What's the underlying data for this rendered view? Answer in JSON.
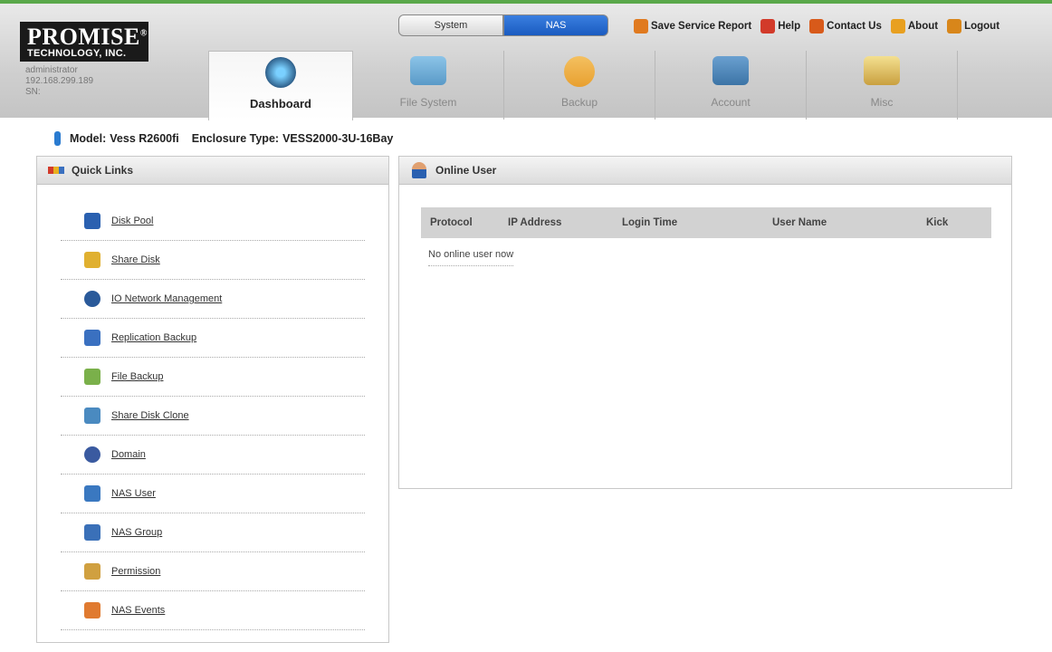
{
  "brand": {
    "name": "PROMISE",
    "registered": "®",
    "subline": "TECHNOLOGY, INC."
  },
  "user": {
    "name": "administrator",
    "ip": "192.168.299.189",
    "sn": "SN:"
  },
  "mode_tabs": [
    {
      "label": "System"
    },
    {
      "label": "NAS"
    }
  ],
  "top_links": [
    {
      "label": "Save Service Report",
      "icon": "report-icon",
      "color": "#e07a1f"
    },
    {
      "label": "Help",
      "icon": "help-icon",
      "color": "#d23a2a"
    },
    {
      "label": "Contact Us",
      "icon": "contact-icon",
      "color": "#d85a1a"
    },
    {
      "label": "About",
      "icon": "about-icon",
      "color": "#e8a020"
    },
    {
      "label": "Logout",
      "icon": "logout-icon",
      "color": "#d8861a"
    }
  ],
  "nav_tabs": [
    {
      "label": "Dashboard",
      "icon": "gauge-icon",
      "color": "#2e5f8a"
    },
    {
      "label": "File System",
      "icon": "folder-gear-icon",
      "color": "#5a9ac8"
    },
    {
      "label": "Backup",
      "icon": "backup-icon",
      "color": "#e8a030"
    },
    {
      "label": "Account",
      "icon": "account-icon",
      "color": "#3c74a6"
    },
    {
      "label": "Misc",
      "icon": "notepad-icon",
      "color": "#c9a040"
    }
  ],
  "model": {
    "model_label": "Model:",
    "model_value": "Vess R2600fi",
    "enclosure_label": "Enclosure Type:",
    "enclosure_value": "VESS2000-3U-16Bay"
  },
  "quick_links": {
    "title": "Quick Links",
    "items": [
      {
        "label": "Disk Pool",
        "icon": "disk-pool-icon",
        "color": "#2a60b0"
      },
      {
        "label": "Share Disk",
        "icon": "share-disk-icon",
        "color": "#e0b030"
      },
      {
        "label": "IO Network Management",
        "icon": "network-icon",
        "color": "#2a5a9a"
      },
      {
        "label": "Replication Backup",
        "icon": "replication-icon",
        "color": "#3a70c0"
      },
      {
        "label": "File Backup",
        "icon": "file-backup-icon",
        "color": "#7ab04a"
      },
      {
        "label": "Share Disk Clone",
        "icon": "clone-icon",
        "color": "#4a8ac0"
      },
      {
        "label": "Domain",
        "icon": "domain-icon",
        "color": "#3a5aa0"
      },
      {
        "label": "NAS User",
        "icon": "nas-user-icon",
        "color": "#3a78c0"
      },
      {
        "label": "NAS Group",
        "icon": "nas-group-icon",
        "color": "#3a70b8"
      },
      {
        "label": "Permission",
        "icon": "permission-icon",
        "color": "#d0a040"
      },
      {
        "label": "NAS Events",
        "icon": "nas-events-icon",
        "color": "#e07a30"
      }
    ]
  },
  "online_user": {
    "title": "Online User",
    "columns": [
      "Protocol",
      "IP Address",
      "Login Time",
      "User Name",
      "Kick"
    ],
    "empty_text": "No online user now"
  }
}
